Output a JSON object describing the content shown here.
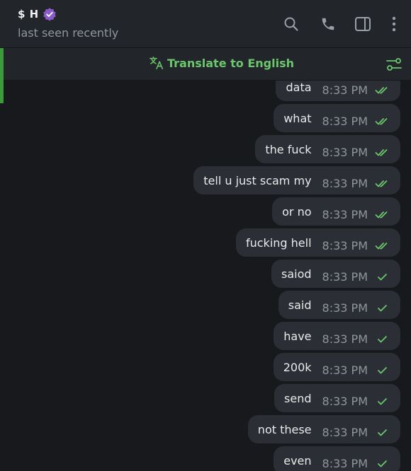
{
  "header": {
    "name": "$ H",
    "status": "last seen recently",
    "icons": [
      "search-icon",
      "phone-icon",
      "sidebar-toggle-icon",
      "more-vertical-icon"
    ]
  },
  "translate": {
    "label": "Translate to English",
    "icon": "translate-icon",
    "settings_icon": "tune-icon"
  },
  "colors": {
    "accent": "#6cc66c",
    "bubble": "#2b2f35",
    "background": "#17191c",
    "verified_badge": "#8b5cc7"
  },
  "messages": [
    {
      "text": "data",
      "time": "8:33 PM",
      "status": "read"
    },
    {
      "text": "what",
      "time": "8:33 PM",
      "status": "read"
    },
    {
      "text": "the fuck",
      "time": "8:33 PM",
      "status": "read"
    },
    {
      "text": "tell u just scam my",
      "time": "8:33 PM",
      "status": "read"
    },
    {
      "text": "or no",
      "time": "8:33 PM",
      "status": "read"
    },
    {
      "text": "fucking hell",
      "time": "8:33 PM",
      "status": "read"
    },
    {
      "text": "saiod",
      "time": "8:33 PM",
      "status": "sent"
    },
    {
      "text": "said",
      "time": "8:33 PM",
      "status": "sent"
    },
    {
      "text": "have",
      "time": "8:33 PM",
      "status": "sent"
    },
    {
      "text": "200k",
      "time": "8:33 PM",
      "status": "sent"
    },
    {
      "text": "send",
      "time": "8:33 PM",
      "status": "sent"
    },
    {
      "text": "not these",
      "time": "8:33 PM",
      "status": "sent"
    },
    {
      "text": "even",
      "time": "8:33 PM",
      "status": "sent"
    }
  ]
}
